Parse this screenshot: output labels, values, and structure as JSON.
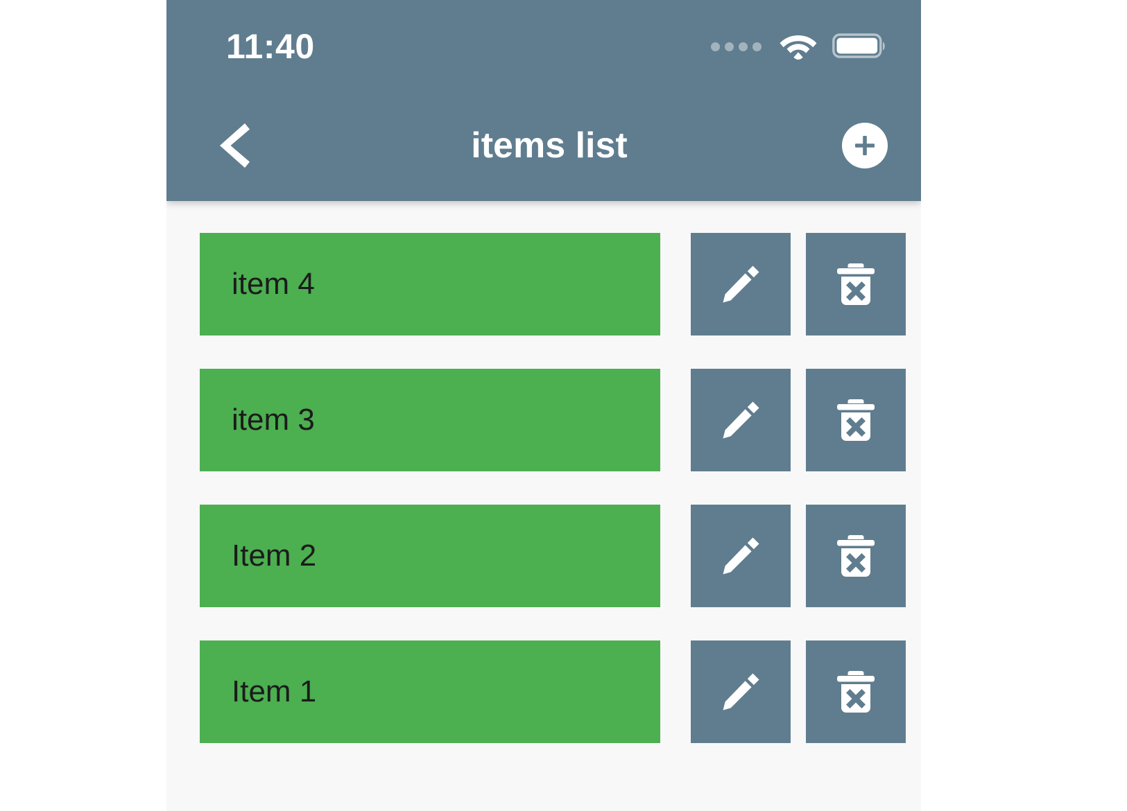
{
  "status_bar": {
    "time": "11:40",
    "signal_dots": 4,
    "wifi_icon": "wifi-icon",
    "battery_icon": "battery-full-icon"
  },
  "header": {
    "back_icon": "chevron-left-icon",
    "title": "items list",
    "add_icon": "plus-circle-icon",
    "background_color": "#5f7d8f"
  },
  "colors": {
    "accent": "#5f7d8f",
    "item": "#4caf50",
    "page_background": "#f8f8f8"
  },
  "list": {
    "items": [
      {
        "label": "item 4",
        "edit_icon": "pencil-icon",
        "delete_icon": "trash-x-icon"
      },
      {
        "label": "item 3",
        "edit_icon": "pencil-icon",
        "delete_icon": "trash-x-icon"
      },
      {
        "label": "Item 2",
        "edit_icon": "pencil-icon",
        "delete_icon": "trash-x-icon"
      },
      {
        "label": "Item 1",
        "edit_icon": "pencil-icon",
        "delete_icon": "trash-x-icon"
      }
    ]
  }
}
